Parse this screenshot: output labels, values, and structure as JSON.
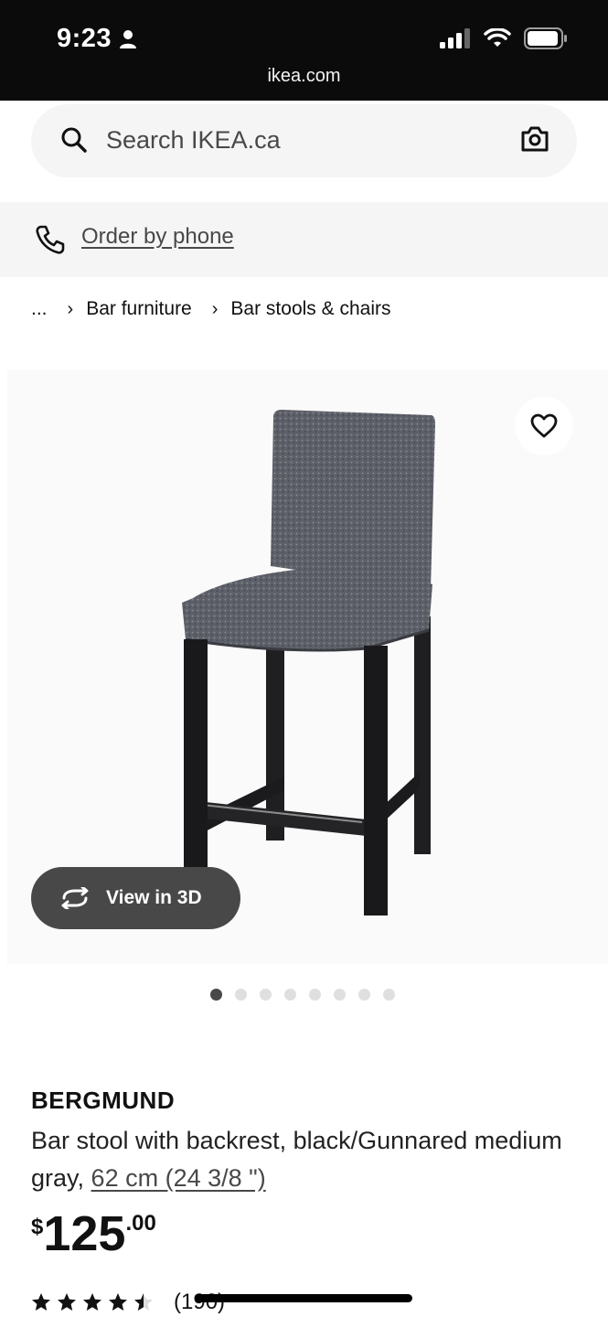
{
  "status_bar": {
    "time": "9:23",
    "url": "ikea.com",
    "icons": [
      "person-icon",
      "signal-icon",
      "wifi-icon",
      "battery-icon"
    ]
  },
  "search": {
    "placeholder": "Search IKEA.ca",
    "icons": [
      "search-icon",
      "camera-icon"
    ]
  },
  "order_by_phone": {
    "label": "Order by phone",
    "icon": "phone-icon"
  },
  "breadcrumb": {
    "items": [
      "...",
      "Bar furniture",
      "Bar stools & chairs"
    ]
  },
  "gallery": {
    "view_3d_label": "View in 3D",
    "dot_count": 8,
    "active_index": 0,
    "icons": [
      "heart-icon",
      "rotate-3d-icon"
    ]
  },
  "product": {
    "name": "BERGMUND",
    "description": "Bar stool with backrest, black/Gunnared medium gray,",
    "measurement": "62 cm (24 3/8 \")",
    "price": {
      "currency": "$",
      "integer": "125",
      "decimal": ".00"
    },
    "rating": {
      "stars": 4.5,
      "max": 5,
      "count": "(190)"
    }
  },
  "colors": {
    "status_bar": "#0b0b0b",
    "panel_gray": "#f5f5f5",
    "button_dark": "#484848",
    "text": "#111111"
  }
}
